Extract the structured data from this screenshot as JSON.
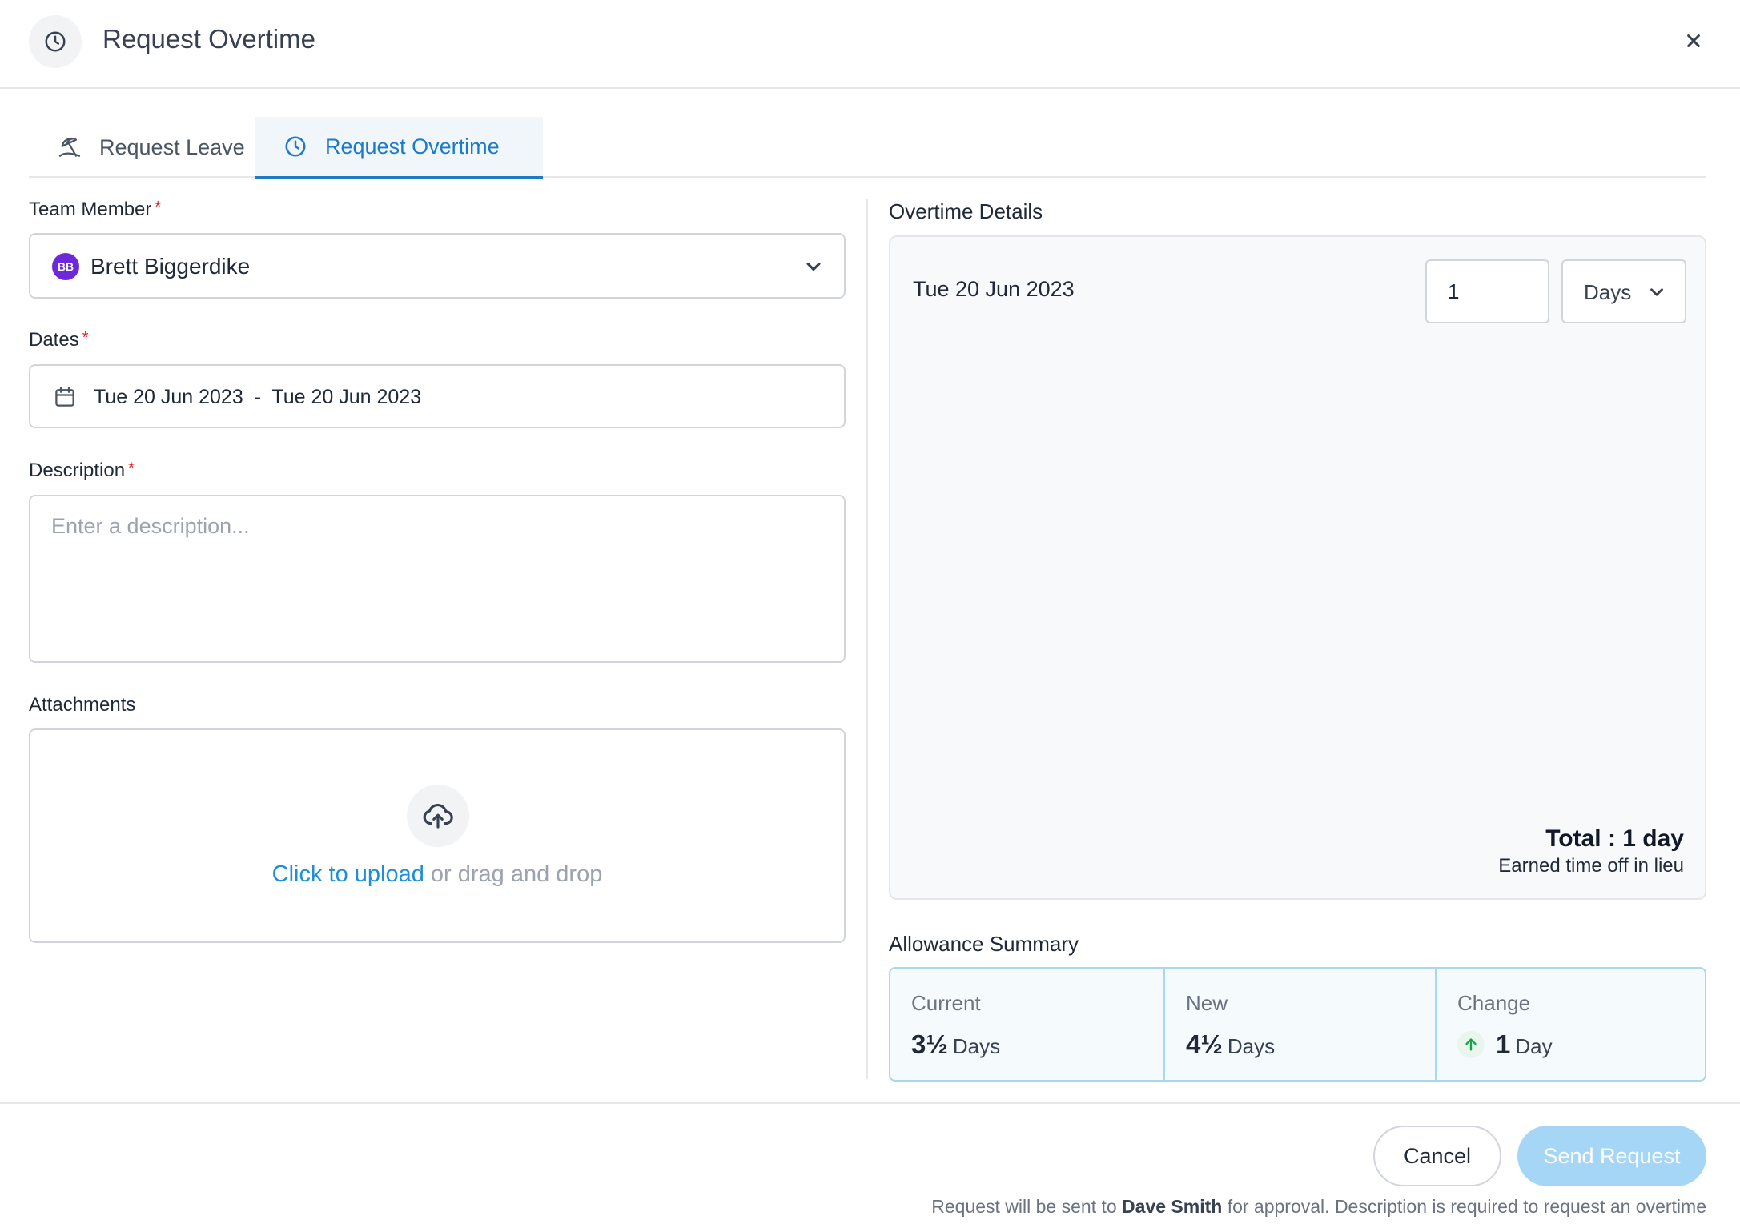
{
  "header": {
    "title": "Request Overtime",
    "icon": "clock-icon",
    "close_icon": "close-icon"
  },
  "tabs": [
    {
      "label": "Request Leave",
      "icon": "beach-umbrella-icon",
      "active": false
    },
    {
      "label": "Request Overtime",
      "icon": "clock-icon",
      "active": true
    }
  ],
  "form": {
    "team_member": {
      "label": "Team Member",
      "required": "*",
      "avatar_initials": "BB",
      "value": "Brett Biggerdike"
    },
    "dates": {
      "label": "Dates",
      "required": "*",
      "value": "Tue 20 Jun 2023  -  Tue 20 Jun 2023"
    },
    "description": {
      "label": "Description",
      "required": "*",
      "placeholder": "Enter a description...",
      "value": ""
    },
    "attachments": {
      "label": "Attachments",
      "upload_link": "Click to upload",
      "upload_rest": " or drag and drop"
    }
  },
  "overtime": {
    "title": "Overtime Details",
    "rows": [
      {
        "date": "Tue 20 Jun 2023",
        "quantity": "1",
        "unit": "Days"
      }
    ],
    "total": "Total : 1 day",
    "total_sub": "Earned time off in lieu"
  },
  "allowance": {
    "title": "Allowance Summary",
    "current": {
      "label": "Current",
      "value": "3½",
      "unit": "Days"
    },
    "new": {
      "label": "New",
      "value": "4½",
      "unit": "Days"
    },
    "change": {
      "label": "Change",
      "value": "1",
      "unit": "Day",
      "direction": "up"
    }
  },
  "footer": {
    "cancel_label": "Cancel",
    "send_label": "Send Request",
    "note_prefix": "Request will be sent to ",
    "approver": "Dave Smith",
    "note_suffix": " for approval. Description is required to request an overtime"
  },
  "colors": {
    "accent": "#1d7ac7",
    "link": "#1d8fd6",
    "send_disabled": "#a6d6f5",
    "avatar": "#6d28d9",
    "required": "#dc2626",
    "change_up": "#16a34a"
  }
}
